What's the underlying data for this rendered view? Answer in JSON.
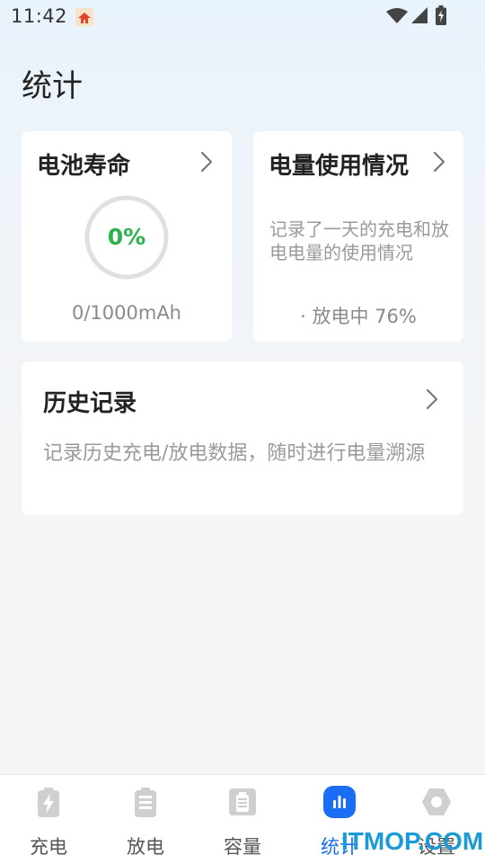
{
  "status_bar": {
    "time": "11:42"
  },
  "page": {
    "title": "统计"
  },
  "battery_life_card": {
    "title": "电池寿命",
    "percent_label": "0%",
    "percent_value": 0,
    "capacity": "0/1000mAh"
  },
  "usage_card": {
    "title": "电量使用情况",
    "description": "记录了一天的充电和放电电量的使用情况",
    "status": "· 放电中 76%"
  },
  "history_card": {
    "title": "历史记录",
    "description": "记录历史充电/放电数据，随时进行电量溯源"
  },
  "bottom_nav": {
    "items": [
      {
        "label": "充电",
        "icon": "battery-charge-icon",
        "active": false
      },
      {
        "label": "放电",
        "icon": "battery-icon",
        "active": false
      },
      {
        "label": "容量",
        "icon": "capacity-icon",
        "active": false
      },
      {
        "label": "统计",
        "icon": "stats-icon",
        "active": true
      },
      {
        "label": "设置",
        "icon": "settings-icon",
        "active": false
      }
    ]
  },
  "watermark": "ITMOP.COM",
  "colors": {
    "accent": "#1b6ef3",
    "success": "#2bb24c",
    "muted": "#9a9a9a"
  }
}
